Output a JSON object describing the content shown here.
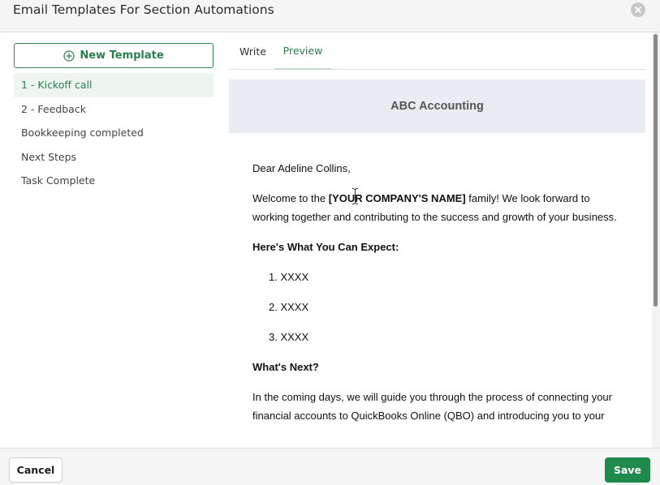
{
  "header": {
    "title": "Email Templates For Section Automations",
    "close_icon": "close-icon"
  },
  "sidebar": {
    "new_template_label": "New Template",
    "new_template_icon": "plus-circle-icon",
    "items": [
      {
        "label": "1 - Kickoff call",
        "active": true
      },
      {
        "label": "2 - Feedback",
        "active": false
      },
      {
        "label": "Bookkeeping completed",
        "active": false
      },
      {
        "label": "Next Steps",
        "active": false
      },
      {
        "label": "Task Complete",
        "active": false
      }
    ]
  },
  "tabs": {
    "write": "Write",
    "preview": "Preview",
    "selected": "Preview"
  },
  "preview": {
    "company_banner": "ABC Accounting",
    "greeting": "Dear Adeline Collins,",
    "welcome_prefix": "Welcome to the ",
    "welcome_company": "[YOUR COMPANY'S NAME]",
    "welcome_suffix": " family! We look forward to working together and contributing to the success and growth of your business.",
    "expect_heading": "Here's What You Can Expect:",
    "list_items": [
      "1. XXXX",
      "2. XXXX",
      "3. XXXX"
    ],
    "next_heading": "What's Next?",
    "next_paragraph": "In the coming days, we will guide you through the process of connecting your financial accounts to QuickBooks Online (QBO) and introducing you to your"
  },
  "footer": {
    "cancel_label": "Cancel",
    "save_label": "Save"
  },
  "colors": {
    "accent_green": "#1e8a4c",
    "active_item_bg": "#eef5ef",
    "banner_bg": "#e9ecf0"
  }
}
